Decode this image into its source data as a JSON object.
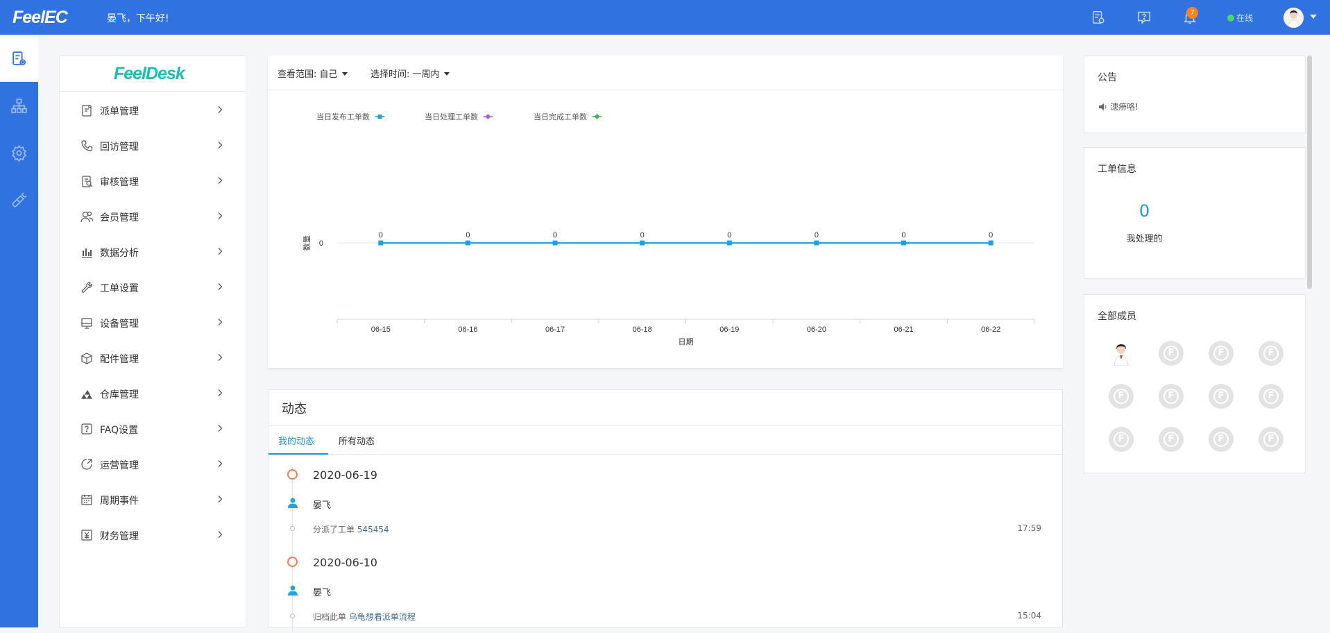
{
  "header": {
    "brand": "FeelEC",
    "greeting": "晏飞，下午好!",
    "notification_count": "7",
    "status": "在线",
    "icons": [
      "task-setting-icon",
      "help-icon",
      "bell-icon",
      "user-avatar",
      "dropdown-caret"
    ]
  },
  "rail": {
    "items": [
      "workorder-setting-icon",
      "org-tree-icon",
      "settings-icon",
      "plug-icon"
    ]
  },
  "menu": {
    "brand": "FeelDesk",
    "items": [
      {
        "label": "派单管理",
        "icon": "dispatch-icon"
      },
      {
        "label": "回访管理",
        "icon": "phone-icon"
      },
      {
        "label": "审核管理",
        "icon": "audit-icon"
      },
      {
        "label": "会员管理",
        "icon": "members-icon"
      },
      {
        "label": "数据分析",
        "icon": "bar-chart-icon"
      },
      {
        "label": "工单设置",
        "icon": "wrench-icon"
      },
      {
        "label": "设备管理",
        "icon": "device-icon"
      },
      {
        "label": "配件管理",
        "icon": "package-icon"
      },
      {
        "label": "仓库管理",
        "icon": "warehouse-icon"
      },
      {
        "label": "FAQ设置",
        "icon": "faq-icon"
      },
      {
        "label": "运营管理",
        "icon": "operation-icon"
      },
      {
        "label": "周期事件",
        "icon": "calendar-icon"
      },
      {
        "label": "财务管理",
        "icon": "finance-icon"
      }
    ]
  },
  "filters": {
    "scope": "查看范围: 自己",
    "time": "选择时间: 一周内"
  },
  "chart_data": {
    "type": "line",
    "x": [
      "06-15",
      "06-16",
      "06-17",
      "06-18",
      "06-19",
      "06-20",
      "06-21",
      "06-22"
    ],
    "series": [
      {
        "name": "当日发布工单数",
        "values": [
          0,
          0,
          0,
          0,
          0,
          0,
          0,
          0
        ],
        "color": "#1ba1e6"
      },
      {
        "name": "当日处理工单数",
        "values": [
          0,
          0,
          0,
          0,
          0,
          0,
          0,
          0
        ],
        "color": "#a45ee5"
      },
      {
        "name": "当日完成工单数",
        "values": [
          0,
          0,
          0,
          0,
          0,
          0,
          0,
          0
        ],
        "color": "#43b649"
      }
    ],
    "xlabel": "日期",
    "ylabel": "数量",
    "yticks": [
      0
    ],
    "legend": "top-left",
    "data_labels": true
  },
  "activity": {
    "title": "动态",
    "tabs": [
      "我的动态",
      "所有动态"
    ],
    "entries": [
      {
        "date": "2020-06-19",
        "user": "晏飞",
        "action": "分派了工单",
        "ticket": "545454",
        "time": "17:59"
      },
      {
        "date": "2020-06-10",
        "user": "晏飞",
        "action": "归档此单",
        "ticket": "乌龟想看派单流程",
        "time": "15:04"
      }
    ]
  },
  "notice": {
    "title": "公告",
    "text": "漶痨咯!"
  },
  "ticket_info": {
    "title": "工单信息",
    "count": "0",
    "label": "我处理的"
  },
  "members": {
    "title": "全部成员",
    "count": 12,
    "placeholder_glyph": "F"
  }
}
